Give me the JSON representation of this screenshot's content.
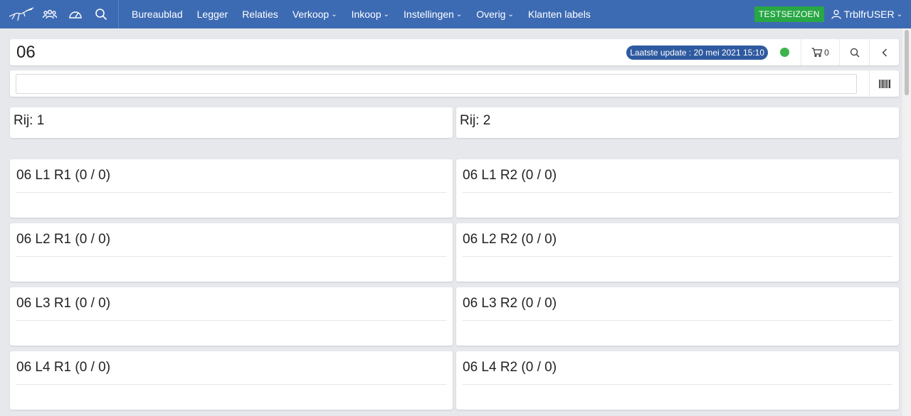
{
  "nav": {
    "items": [
      {
        "label": "Bureaublad",
        "dropdown": false
      },
      {
        "label": "Legger",
        "dropdown": false
      },
      {
        "label": "Relaties",
        "dropdown": false
      },
      {
        "label": "Verkoop",
        "dropdown": true
      },
      {
        "label": "Inkoop",
        "dropdown": true
      },
      {
        "label": "Instellingen",
        "dropdown": true
      },
      {
        "label": "Overig",
        "dropdown": true
      },
      {
        "label": "Klanten labels",
        "dropdown": false
      }
    ],
    "season_badge": "TESTSEIZOEN",
    "user": "TrblfrUSER"
  },
  "header": {
    "title": "06",
    "last_update": "Laatste update : 20 mei 2021 15:10",
    "cart_count": "0"
  },
  "search": {
    "value": "",
    "placeholder": ""
  },
  "rows": [
    {
      "label": "Rij: 1"
    },
    {
      "label": "Rij: 2"
    }
  ],
  "cards": [
    {
      "title": "06 L1 R1 (0 / 0)"
    },
    {
      "title": "06 L1 R2 (0 / 0)"
    },
    {
      "title": "06 L2 R1 (0 / 0)"
    },
    {
      "title": "06 L2 R2 (0 / 0)"
    },
    {
      "title": "06 L3 R1 (0 / 0)"
    },
    {
      "title": "06 L3 R2 (0 / 0)"
    },
    {
      "title": "06 L4 R1 (0 / 0)"
    },
    {
      "title": "06 L4 R2 (0 / 0)"
    }
  ],
  "colors": {
    "nav_bg": "#3d6bb3",
    "badge_green": "#28a745",
    "status_green": "#3cb44b",
    "pill_blue": "#2f5aa0"
  }
}
